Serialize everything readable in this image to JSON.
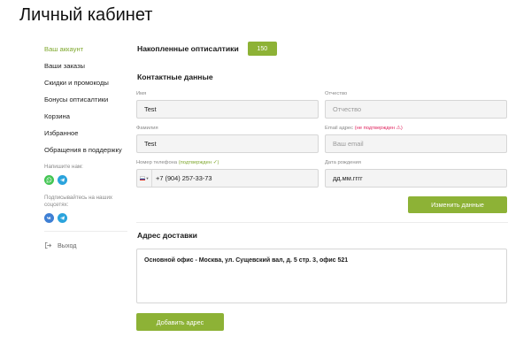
{
  "page": {
    "title": "Личный кабинет"
  },
  "colors": {
    "accent": "#8db236",
    "accent_text": "#7fa82e",
    "warning": "#e0245e",
    "whatsapp": "#43c553",
    "telegram": "#2aa3dc",
    "vk": "#3e7fd4"
  },
  "sidebar": {
    "items": [
      {
        "label": "Ваш аккаунт",
        "active": true
      },
      {
        "label": "Ваши заказы"
      },
      {
        "label": "Скидки и промокоды"
      },
      {
        "label": "Бонусы оптисалтики"
      },
      {
        "label": "Корзина"
      },
      {
        "label": "Избранное"
      },
      {
        "label": "Обращения в поддержку"
      }
    ],
    "write_us_label": "Напишите нам:",
    "write_us_icons": [
      "whatsapp-icon",
      "telegram-icon"
    ],
    "subscribe_label": "Подписывайтесь на наших соцсетях:",
    "subscribe_icons": [
      "vk-icon",
      "telegram-icon"
    ],
    "logout_label": "Выход"
  },
  "bonus": {
    "label": "Накопленные оптисалтики",
    "value": "150"
  },
  "contacts": {
    "title": "Контактные данные",
    "first_name": {
      "label": "Имя",
      "value": "Test"
    },
    "patronymic": {
      "label": "Отчество",
      "placeholder": "Отчество"
    },
    "last_name": {
      "label": "Фамилия",
      "value": "Test"
    },
    "email": {
      "label": "Email адрес",
      "status": "(не подтвержден ⚠)",
      "placeholder": "Ваш email"
    },
    "phone": {
      "label": "Номер телефона",
      "status": "(подтвержден ✓)",
      "value": "+7 (904) 257-33-73"
    },
    "birthdate": {
      "label": "Дата рождения",
      "placeholder": "дд.мм.гггг"
    },
    "save_button": "Изменить данные"
  },
  "delivery": {
    "title": "Адрес доставки",
    "address": "Основной офис - Москва, ул. Сущевский вал, д. 5 стр. 3, офис 521",
    "add_button": "Добавить адрес"
  }
}
